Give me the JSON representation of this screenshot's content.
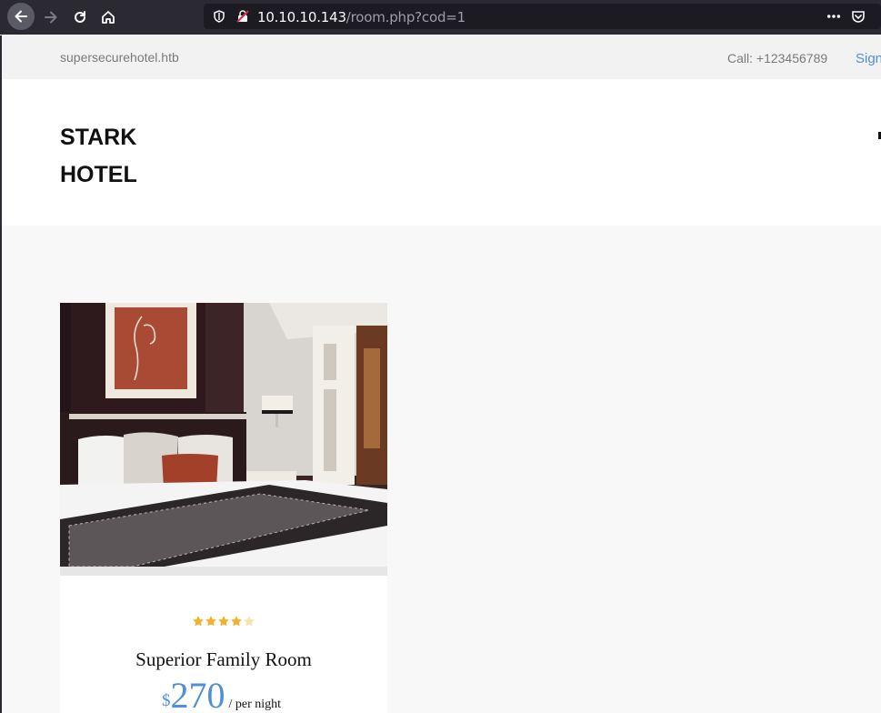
{
  "browser": {
    "url_host": "10.10.10.143",
    "url_path": "/room.php?cod=1"
  },
  "topbar": {
    "domain": "supersecurehotel.htb",
    "phone": "Call: +123456789",
    "signin": "Sign"
  },
  "header": {
    "logo_line1": "STARK",
    "logo_line2": "HOTEL"
  },
  "room": {
    "rating": 4,
    "rating_max": 5,
    "title": "Superior Family Room",
    "currency": "$",
    "price": "270",
    "per": "/ per night"
  },
  "colors": {
    "accent": "#4e8fd8",
    "star": "#f5b023",
    "star_empty": "#f8e1b0"
  }
}
